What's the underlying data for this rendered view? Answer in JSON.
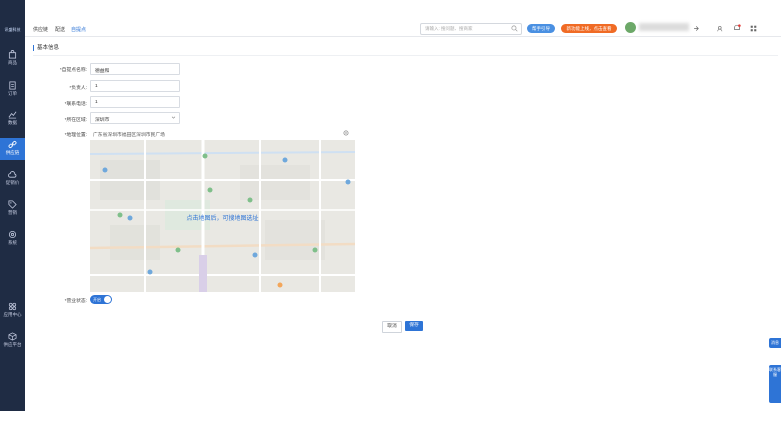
{
  "app": {
    "logo_text": "讯盛科技"
  },
  "sidebar": {
    "items": [
      {
        "label": "商品",
        "icon": "bag-icon"
      },
      {
        "label": "订单",
        "icon": "document-icon"
      },
      {
        "label": "数据",
        "icon": "chart-icon"
      },
      {
        "label": "供应链",
        "icon": "link-icon",
        "active": true
      },
      {
        "label": "促销价",
        "icon": "cloud-icon"
      },
      {
        "label": "营销",
        "icon": "tag-icon"
      },
      {
        "label": "系统",
        "icon": "gear-icon"
      },
      {
        "label": "应用中心",
        "icon": "apps-icon"
      },
      {
        "label": "供应平台",
        "icon": "cube-icon"
      }
    ]
  },
  "header": {
    "crumbs": [
      "供应链",
      "配送",
      "自提点"
    ],
    "search_placeholder": "请输入: 搜问题、搜商家",
    "btn_help": "帮手引导",
    "btn_promo": "新功能上线，点击查看",
    "accent": "#2e74d6",
    "promo_color": "#f06b25"
  },
  "form": {
    "section_title": "基本信息",
    "labels": {
      "name": "*自提点名称:",
      "contact": "*负责人:",
      "phone": "*联系电话:",
      "area": "*所在区域:",
      "address": "*地理位置:",
      "status": "*营业状态:"
    },
    "values": {
      "name": "德益和",
      "contact": "1",
      "phone": "1",
      "area": "深圳市",
      "address": "广东省深圳市福田区深圳市民广场"
    },
    "map_hint": "点击地图后，可搜地图选址",
    "toggle_text": "开启",
    "cancel": "取消",
    "save": "保存"
  },
  "side_tabs": {
    "top": "消息",
    "bottom": "联系客服"
  }
}
